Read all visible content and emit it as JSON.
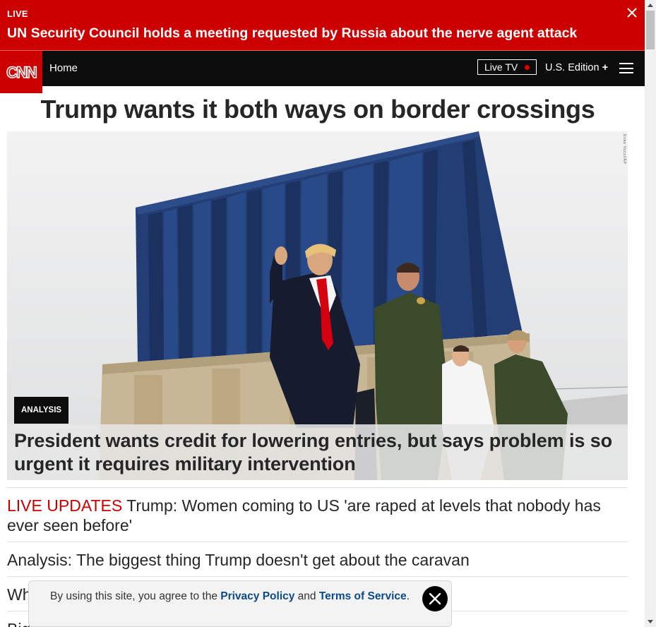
{
  "live_banner": {
    "label": "LIVE",
    "headline": "UN Security Council holds a meeting requested by Russia about the nerve agent attack"
  },
  "nav": {
    "logo_text": "CNN",
    "home": "Home",
    "live_tv": "Live TV",
    "edition": "U.S. Edition",
    "edition_plus": "+"
  },
  "main": {
    "title": "Trump wants it both ways on border crossings",
    "hero": {
      "badge": "ANALYSIS",
      "caption": "President wants credit for lowering entries, but says problem is so urgent it requires military intervention",
      "credit": "Evan Vucci/AP"
    },
    "stories": [
      {
        "prefix": "LIVE UPDATES",
        "text": " Trump: Women coming to US 'are raped at levels that nobody has ever seen before'"
      },
      {
        "prefix": "",
        "text": "Analysis: The biggest thing Trump doesn't get about the caravan"
      },
      {
        "prefix": "",
        "text": "Wh"
      },
      {
        "prefix": "",
        "text": "Big"
      }
    ]
  },
  "cookie": {
    "text_before": "By using this site, you agree to the ",
    "privacy_link": "Privacy Policy",
    "text_and": " and ",
    "terms_link": "Terms of Service",
    "text_after": "."
  },
  "colors": {
    "brand_red": "#cc0000",
    "nav_bg": "#0c0c0c",
    "link_blue": "#0c4a8a"
  },
  "icons": [
    "close-icon",
    "cnn-logo",
    "live-dot-icon",
    "hamburger-icon",
    "scroll-up-icon",
    "scroll-down-icon"
  ]
}
